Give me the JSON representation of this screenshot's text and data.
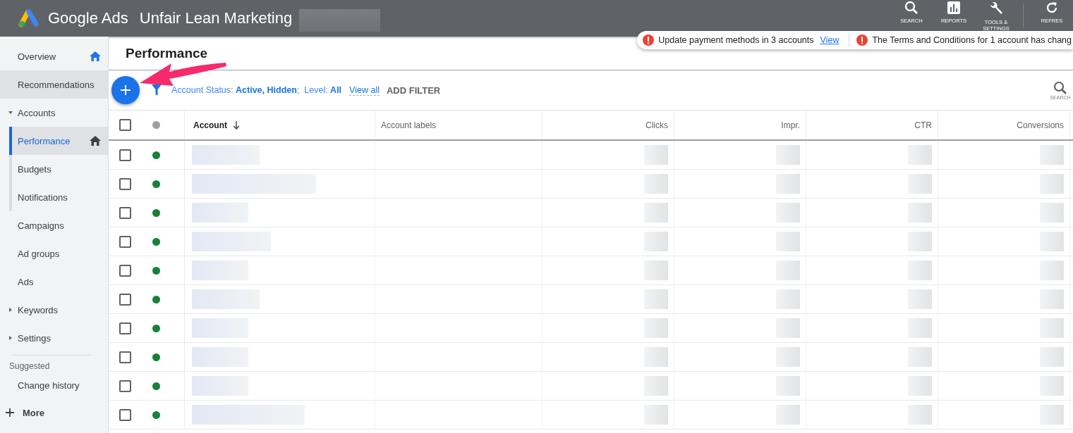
{
  "header": {
    "product": "Google Ads",
    "account": "Unfair Lean Marketing",
    "actions": [
      {
        "label": "SEARCH",
        "kind": "search"
      },
      {
        "label": "REPORTS",
        "kind": "reports"
      },
      {
        "label": "TOOLS &\nSETTINGS",
        "kind": "tools"
      },
      {
        "label": "REFRES",
        "kind": "refresh"
      }
    ]
  },
  "notifications": [
    {
      "text": "Update payment methods in 3 accounts",
      "link": "View"
    },
    {
      "text": "The Terms and Conditions for 1 account has chang"
    }
  ],
  "sidebar": {
    "items": [
      {
        "label": "Overview",
        "selected": false,
        "highlighted": false,
        "home": true
      },
      {
        "label": "Recommendations",
        "selected": false,
        "highlighted": true,
        "home": false
      },
      {
        "label": "Accounts",
        "selected": false,
        "highlighted": false,
        "home": false,
        "expanded": true,
        "children": [
          {
            "label": "Performance",
            "selected": true,
            "highlighted": false,
            "home": true
          },
          {
            "label": "Budgets",
            "selected": false,
            "highlighted": false,
            "home": false
          },
          {
            "label": "Notifications",
            "selected": false,
            "highlighted": false,
            "home": false
          }
        ]
      },
      {
        "label": "Campaigns",
        "selected": false,
        "highlighted": false,
        "home": false
      },
      {
        "label": "Ad groups",
        "selected": false,
        "highlighted": false,
        "home": false
      },
      {
        "label": "Ads",
        "selected": false,
        "highlighted": false,
        "home": false
      },
      {
        "label": "Keywords",
        "selected": false,
        "highlighted": false,
        "home": false,
        "expanded": false
      },
      {
        "label": "Settings",
        "selected": false,
        "highlighted": false,
        "home": false,
        "expanded": false
      }
    ],
    "suggested_heading": "Suggested",
    "suggested": [
      {
        "label": "Change history",
        "selected": false
      }
    ],
    "more": "More"
  },
  "page_title": "Performance",
  "filter": {
    "text": "Account Status: **Active, Hidden**;  Level: **All**",
    "view_all": "View all",
    "add_filter": "ADD FILTER",
    "search": "SEARCH"
  },
  "table": {
    "select_all": {
      "checked": false
    },
    "columns": [
      {
        "label": "Account",
        "kind": "text",
        "sorted": true
      },
      {
        "label": "Account labels",
        "kind": "text",
        "sorted": false
      },
      {
        "label": "Clicks",
        "kind": "number",
        "sorted": false
      },
      {
        "label": "Impr.",
        "kind": "number",
        "sorted": false
      },
      {
        "label": "CTR",
        "kind": "number",
        "sorted": false
      },
      {
        "label": "Conversions",
        "kind": "number",
        "sorted": false
      }
    ],
    "rows": [
      {
        "selected": false,
        "color": "#188038"
      },
      {
        "selected": false,
        "color": "#188038"
      },
      {
        "selected": false,
        "color": "#188038"
      },
      {
        "selected": false,
        "color": "#188038"
      },
      {
        "selected": false,
        "color": "#188038"
      },
      {
        "selected": false,
        "color": "#188038"
      },
      {
        "selected": false,
        "color": "#188038"
      },
      {
        "selected": false,
        "color": "#188038"
      },
      {
        "selected": false,
        "color": "#188038"
      },
      {
        "selected": false,
        "color": "#188038"
      }
    ]
  }
}
